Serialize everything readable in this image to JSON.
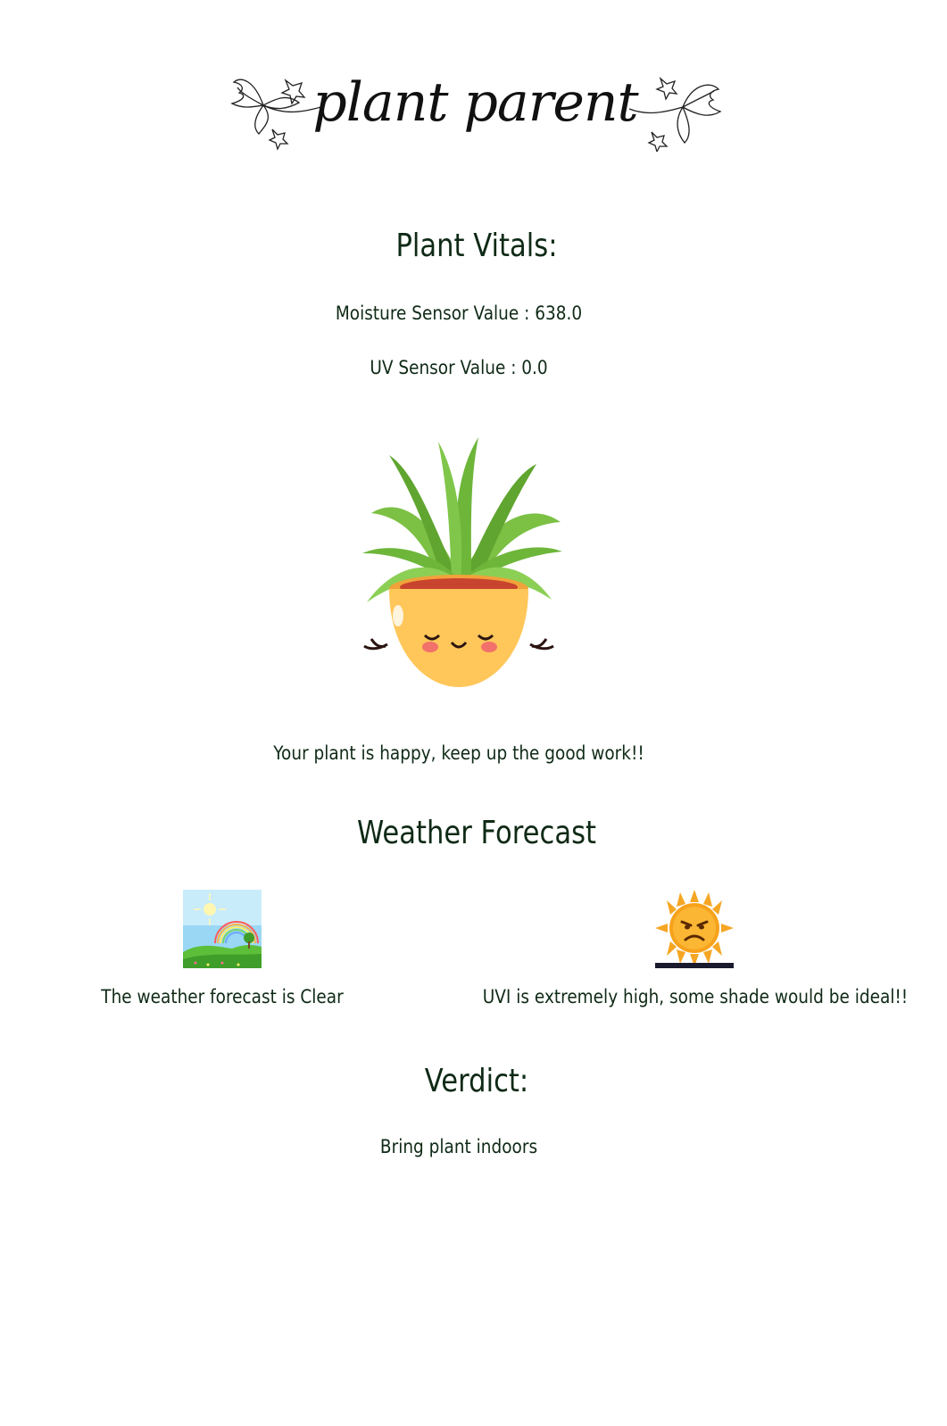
{
  "logo": {
    "text": "plant parent",
    "icon": "maple-leaves"
  },
  "vitals": {
    "heading": "Plant Vitals:",
    "moisture": "Moisture Sensor Value : 638.0",
    "uv": "UV Sensor Value : 0.0",
    "image_icon": "happy-potted-plant",
    "status_message": "Your plant is happy, keep up the good work!!"
  },
  "forecast": {
    "heading": "Weather Forecast",
    "weather_icon": "sunny-rainbow-landscape",
    "weather_text": "The weather forecast is Clear",
    "uv_icon": "angry-sun",
    "uv_text": "UVI is extremely high, some shade would be ideal!!"
  },
  "verdict": {
    "heading": "Verdict:",
    "text": "Bring plant indoors"
  },
  "colors": {
    "text": "#0f2a16",
    "pot": "#ffc65a",
    "leaf": "#6fb13b",
    "sky": "#8fd3f4",
    "sun": "#f5a623"
  }
}
